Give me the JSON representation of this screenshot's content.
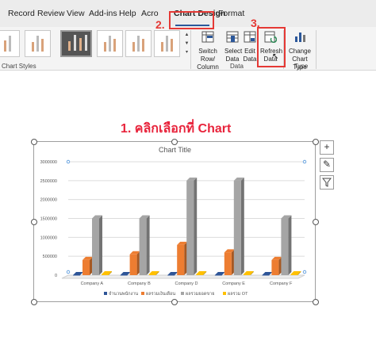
{
  "ribbon": {
    "tabs": [
      {
        "label": "Record"
      },
      {
        "label": "Review"
      },
      {
        "label": "View"
      },
      {
        "label": "Add-ins"
      },
      {
        "label": "Help"
      },
      {
        "label": "Acro"
      },
      {
        "label": "Chart Design",
        "active": true
      },
      {
        "label": "Format"
      }
    ],
    "groups": {
      "chart_styles_label": "Chart Styles",
      "data_label": "Data",
      "type_label": "Type"
    },
    "buttons": {
      "switch_row_column": {
        "line1": "Switch Row/",
        "line2": "Column",
        "icon": "switch-row-column-icon"
      },
      "select_data": {
        "line1": "Select",
        "line2": "Data",
        "icon": "select-data-icon"
      },
      "edit_data": {
        "line1": "Edit",
        "line2": "Data",
        "icon": "edit-data-icon"
      },
      "refresh_data": {
        "line1": "Refresh",
        "line2": "Data",
        "icon": "refresh-data-icon"
      },
      "change_chart_type": {
        "line1": "Change",
        "line2": "Chart Type",
        "icon": "change-chart-type-icon"
      }
    }
  },
  "annotations": {
    "step1": "1. คลิกเลือกที่ Chart",
    "step2": "2.",
    "step3": "3.",
    "color": "#e53935"
  },
  "chart_data": {
    "type": "bar",
    "title": "Chart Title",
    "categories": [
      "Company A",
      "Company B",
      "Company D",
      "Company E",
      "Company F"
    ],
    "series": [
      {
        "name": "จำนวนพนักงาน",
        "color": "#2e5597",
        "values": [
          30,
          40,
          50,
          35,
          45
        ]
      },
      {
        "name": "ผลรวมเงินเดือน",
        "color": "#ed7d31",
        "values": [
          400000,
          550000,
          800000,
          600000,
          400000
        ]
      },
      {
        "name": "ผลรวมยอดขาย",
        "color": "#a5a5a5",
        "values": [
          1500000,
          1500000,
          2500000,
          2500000,
          1500000
        ]
      },
      {
        "name": "ผลรวม OT",
        "color": "#ffc000",
        "values": [
          20000,
          20000,
          20000,
          20000,
          20000
        ]
      }
    ],
    "ylim": [
      0,
      3000000
    ],
    "yticks": [
      0,
      500000,
      1000000,
      1500000,
      2000000,
      2500000,
      3000000
    ],
    "ytick_labels": [
      "0",
      "500000",
      "1000000",
      "1500000",
      "2000000",
      "2500000",
      "3000000"
    ],
    "grid": true,
    "legend_position": "bottom"
  }
}
